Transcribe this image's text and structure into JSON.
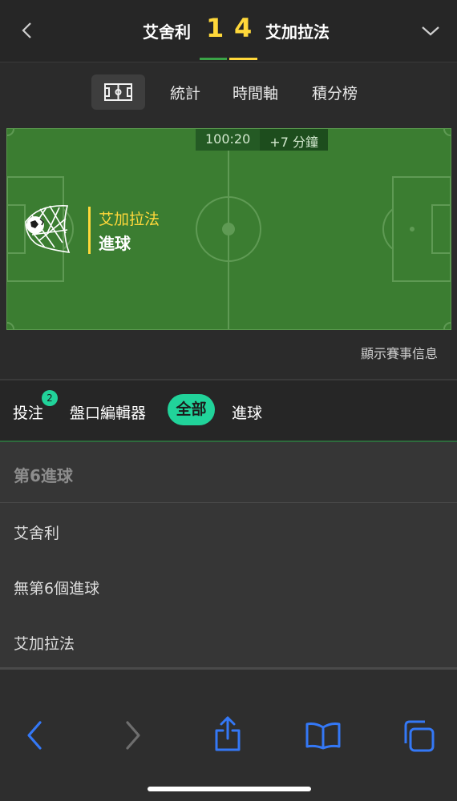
{
  "header": {
    "home_team": "艾舍利",
    "away_team": "艾加拉法",
    "home_score": "1",
    "away_score": "4"
  },
  "tabs": [
    {
      "label": "統計"
    },
    {
      "label": "時間軸"
    },
    {
      "label": "積分榜"
    }
  ],
  "pitch": {
    "clock": "100:20",
    "added_time": "+7 分鐘",
    "event_team": "艾加拉法",
    "event_label": "進球"
  },
  "show_info": "顯示賽事信息",
  "filters": {
    "bets_label": "投注",
    "bets_badge": "2",
    "market_editor": "盤口編輯器",
    "all": "全部",
    "goals": "進球"
  },
  "market": {
    "title": "第6進球",
    "outcomes": [
      "艾舍利",
      "無第6個進球",
      "艾加拉法"
    ]
  },
  "colors": {
    "accent": "#21d39a",
    "score": "#ffd83a",
    "pitch": "#3b7d31",
    "ios_blue": "#3478f6"
  },
  "icons": [
    "back-chevron-icon",
    "dropdown-chevron-icon",
    "pitch-icon",
    "goal-net-icon",
    "share-icon",
    "bookmarks-icon",
    "tabs-icon"
  ]
}
